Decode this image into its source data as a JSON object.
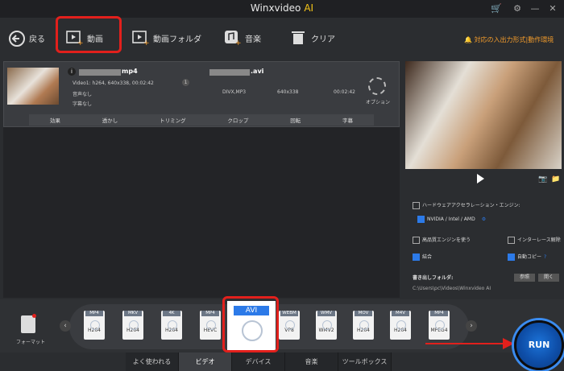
{
  "app": {
    "title": "Winxvideo",
    "title_ai": "AI"
  },
  "toolbar": {
    "back": "戻る",
    "video": "動画",
    "video_folder": "動画フォルダ",
    "music": "音楽",
    "clear": "クリア"
  },
  "format_link": "対応の入出力形式|動作環境",
  "file": {
    "src_name": "mp4",
    "src_info": "Video1: h264, 640x338, 00:02:42",
    "audio": "音声なし",
    "subtitle": "字幕なし",
    "track_num": "1",
    "out_name": ".avi",
    "out_codec": "DIVX,MP3",
    "out_res": "640x338",
    "out_dur": "00:02:42",
    "option": "オプション"
  },
  "edit_bar": [
    "効果",
    "透かし",
    "トリミング",
    "クロップ",
    "回転",
    "字幕"
  ],
  "right": {
    "hw_accel": "ハードウェアアクセラレーション・エンジン:",
    "gpu": "NVIDIA / Intel / AMD",
    "hq_engine": "高品質エンジンを使う",
    "interlace": "インターレース解除",
    "merge": "結合",
    "auto_copy": "自動コピー",
    "out_folder_label": "書き出しフォルダ:",
    "browse": "参照",
    "open": "開く",
    "out_path": "C:\\Users\\pc\\Videos\\Winxvideo AI"
  },
  "format_label": "フォーマット",
  "formats": [
    {
      "tag": "MP4",
      "sub": "H264"
    },
    {
      "tag": "MKV",
      "sub": "H264"
    },
    {
      "tag": "4K",
      "sub": "H264"
    },
    {
      "tag": "MP4",
      "sub": "HEVC"
    },
    {
      "tag": "AVI",
      "sub": ""
    },
    {
      "tag": "WEBM",
      "sub": "VP8"
    },
    {
      "tag": "WMV",
      "sub": "WMV2"
    },
    {
      "tag": "MOV",
      "sub": "H264"
    },
    {
      "tag": "M4V",
      "sub": "H264"
    },
    {
      "tag": "MP4",
      "sub": "MPEG4"
    }
  ],
  "tabs": [
    "よく使われる",
    "ビデオ",
    "デバイス",
    "音楽",
    "ツールボックス"
  ],
  "run": "RUN",
  "colors": {
    "highlight": "#e2201c",
    "accent": "#2c7ae8",
    "link": "#f39c2b"
  }
}
